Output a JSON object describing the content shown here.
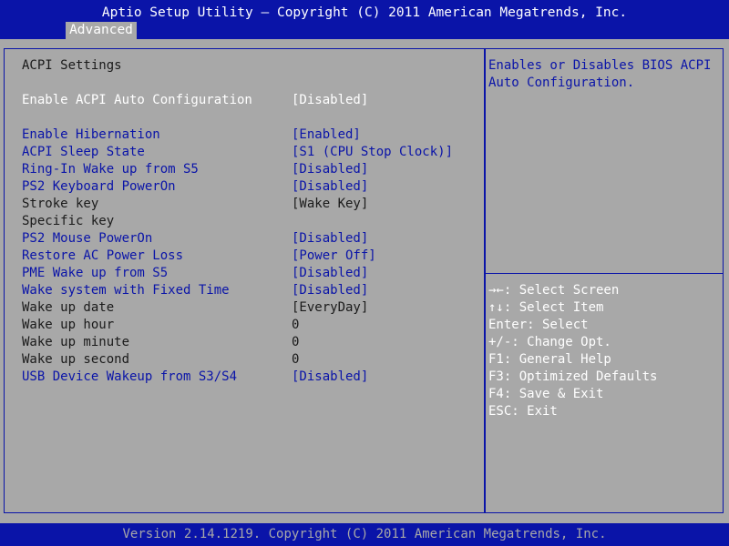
{
  "header": {
    "title": "Aptio Setup Utility – Copyright (C) 2011 American Megatrends, Inc.",
    "tab": "Advanced"
  },
  "section_title": "ACPI Settings",
  "settings": [
    {
      "label": "Enable ACPI Auto Configuration",
      "value": "[Disabled]",
      "selectable": true
    },
    {
      "label": "Enable Hibernation",
      "value": "[Enabled]",
      "selectable": true
    },
    {
      "label": "ACPI Sleep State",
      "value": "[S1 (CPU Stop Clock)]",
      "selectable": true
    },
    {
      "label": "Ring-In Wake up from S5",
      "value": "[Disabled]",
      "selectable": true
    },
    {
      "label": "PS2 Keyboard PowerOn",
      "value": "[Disabled]",
      "selectable": true
    },
    {
      "label": "Stroke key",
      "value": "[Wake Key]",
      "selectable": false
    },
    {
      "label": "Specific key",
      "value": "",
      "selectable": false
    },
    {
      "label": "PS2 Mouse PowerOn",
      "value": "[Disabled]",
      "selectable": true
    },
    {
      "label": "Restore AC Power Loss",
      "value": "[Power Off]",
      "selectable": true
    },
    {
      "label": "PME Wake up from S5",
      "value": "[Disabled]",
      "selectable": true
    },
    {
      "label": "Wake system with Fixed Time",
      "value": "[Disabled]",
      "selectable": true
    },
    {
      "label": "Wake up date",
      "value": "[EveryDay]",
      "selectable": false
    },
    {
      "label": "Wake up hour",
      "value": "0",
      "selectable": false
    },
    {
      "label": "Wake up minute",
      "value": "0",
      "selectable": false
    },
    {
      "label": "Wake up second",
      "value": "0",
      "selectable": false
    },
    {
      "label": "USB Device Wakeup from S3/S4",
      "value": "[Disabled]",
      "selectable": true
    }
  ],
  "help": {
    "line1": "Enables or Disables BIOS ACPI",
    "line2": "Auto Configuration."
  },
  "keys": [
    "→←: Select Screen",
    "↑↓: Select Item",
    "Enter: Select",
    "+/-: Change Opt.",
    "F1: General Help",
    "F3: Optimized Defaults",
    "F4: Save & Exit",
    "ESC: Exit"
  ],
  "footer": "Version 2.14.1219. Copyright (C) 2011 American Megatrends, Inc.",
  "colors": {
    "background": "#a8a8a8",
    "accent_blue": "#0a14a8",
    "text_white": "#ffffff",
    "text_dark": "#1a1a1a"
  }
}
